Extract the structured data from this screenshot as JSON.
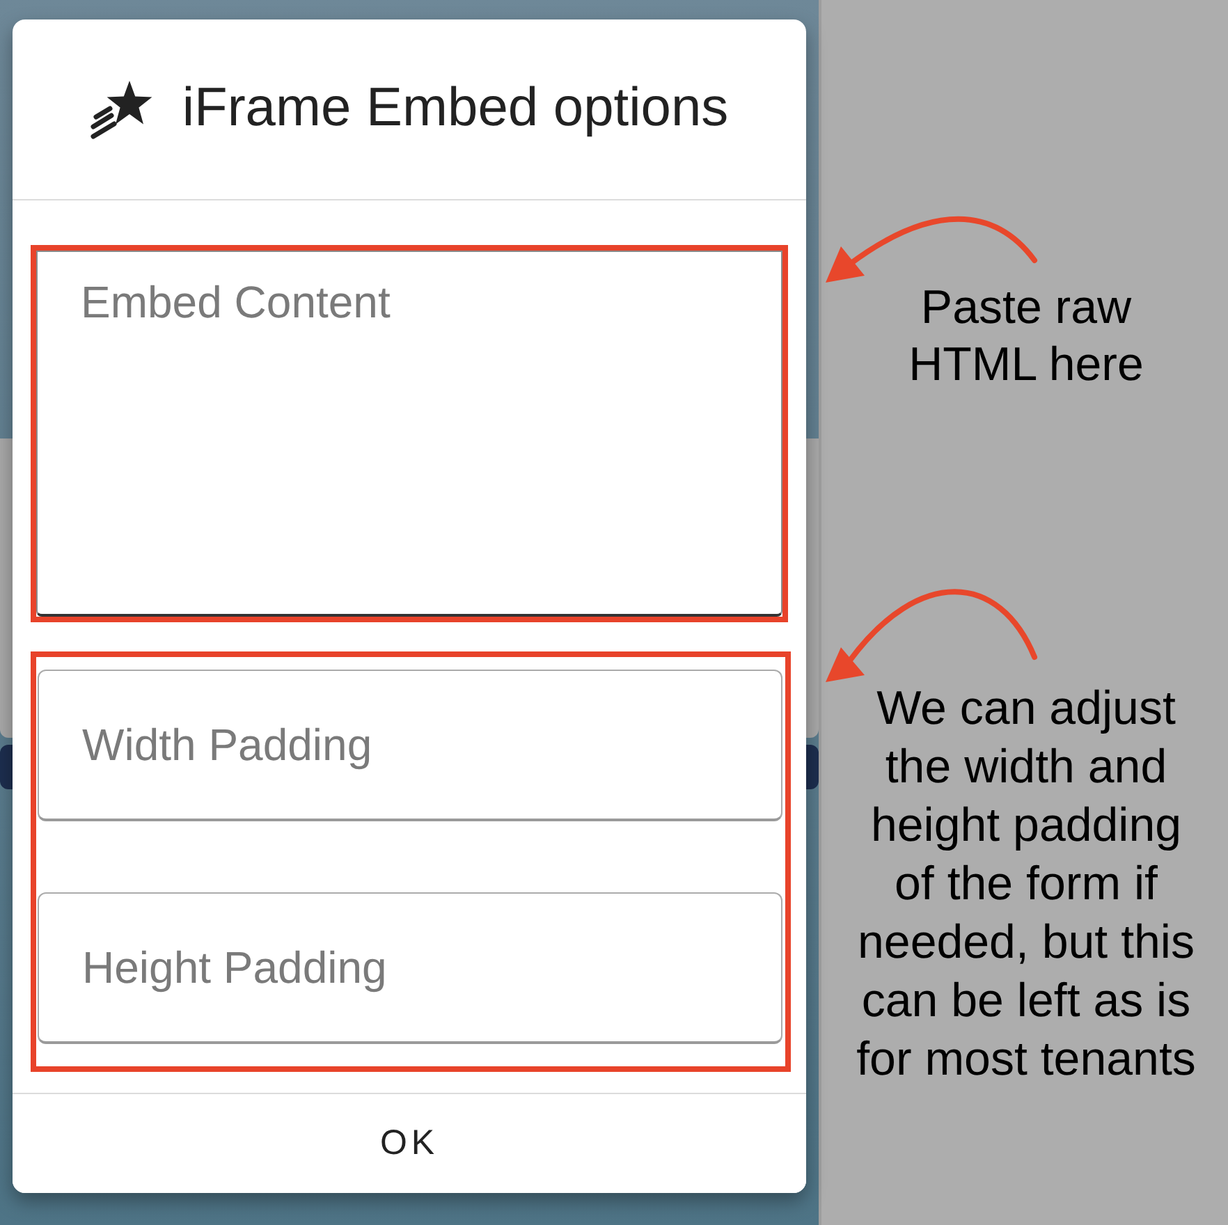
{
  "dialog": {
    "title": "iFrame Embed options",
    "field_groups": [
      {
        "highlighted": true,
        "fields": [
          {
            "kind": "textarea",
            "placeholder": "Embed Content"
          }
        ]
      },
      {
        "highlighted": true,
        "fields": [
          {
            "kind": "input",
            "placeholder": "Width Padding"
          },
          {
            "kind": "input",
            "placeholder": "Height Padding"
          }
        ]
      }
    ],
    "button": "OK"
  },
  "annotations": [
    {
      "text": "Paste raw HTML here"
    },
    {
      "text": "We can adjust the width and height padding of the form if needed, but this can be left as is for most tenants"
    }
  ]
}
